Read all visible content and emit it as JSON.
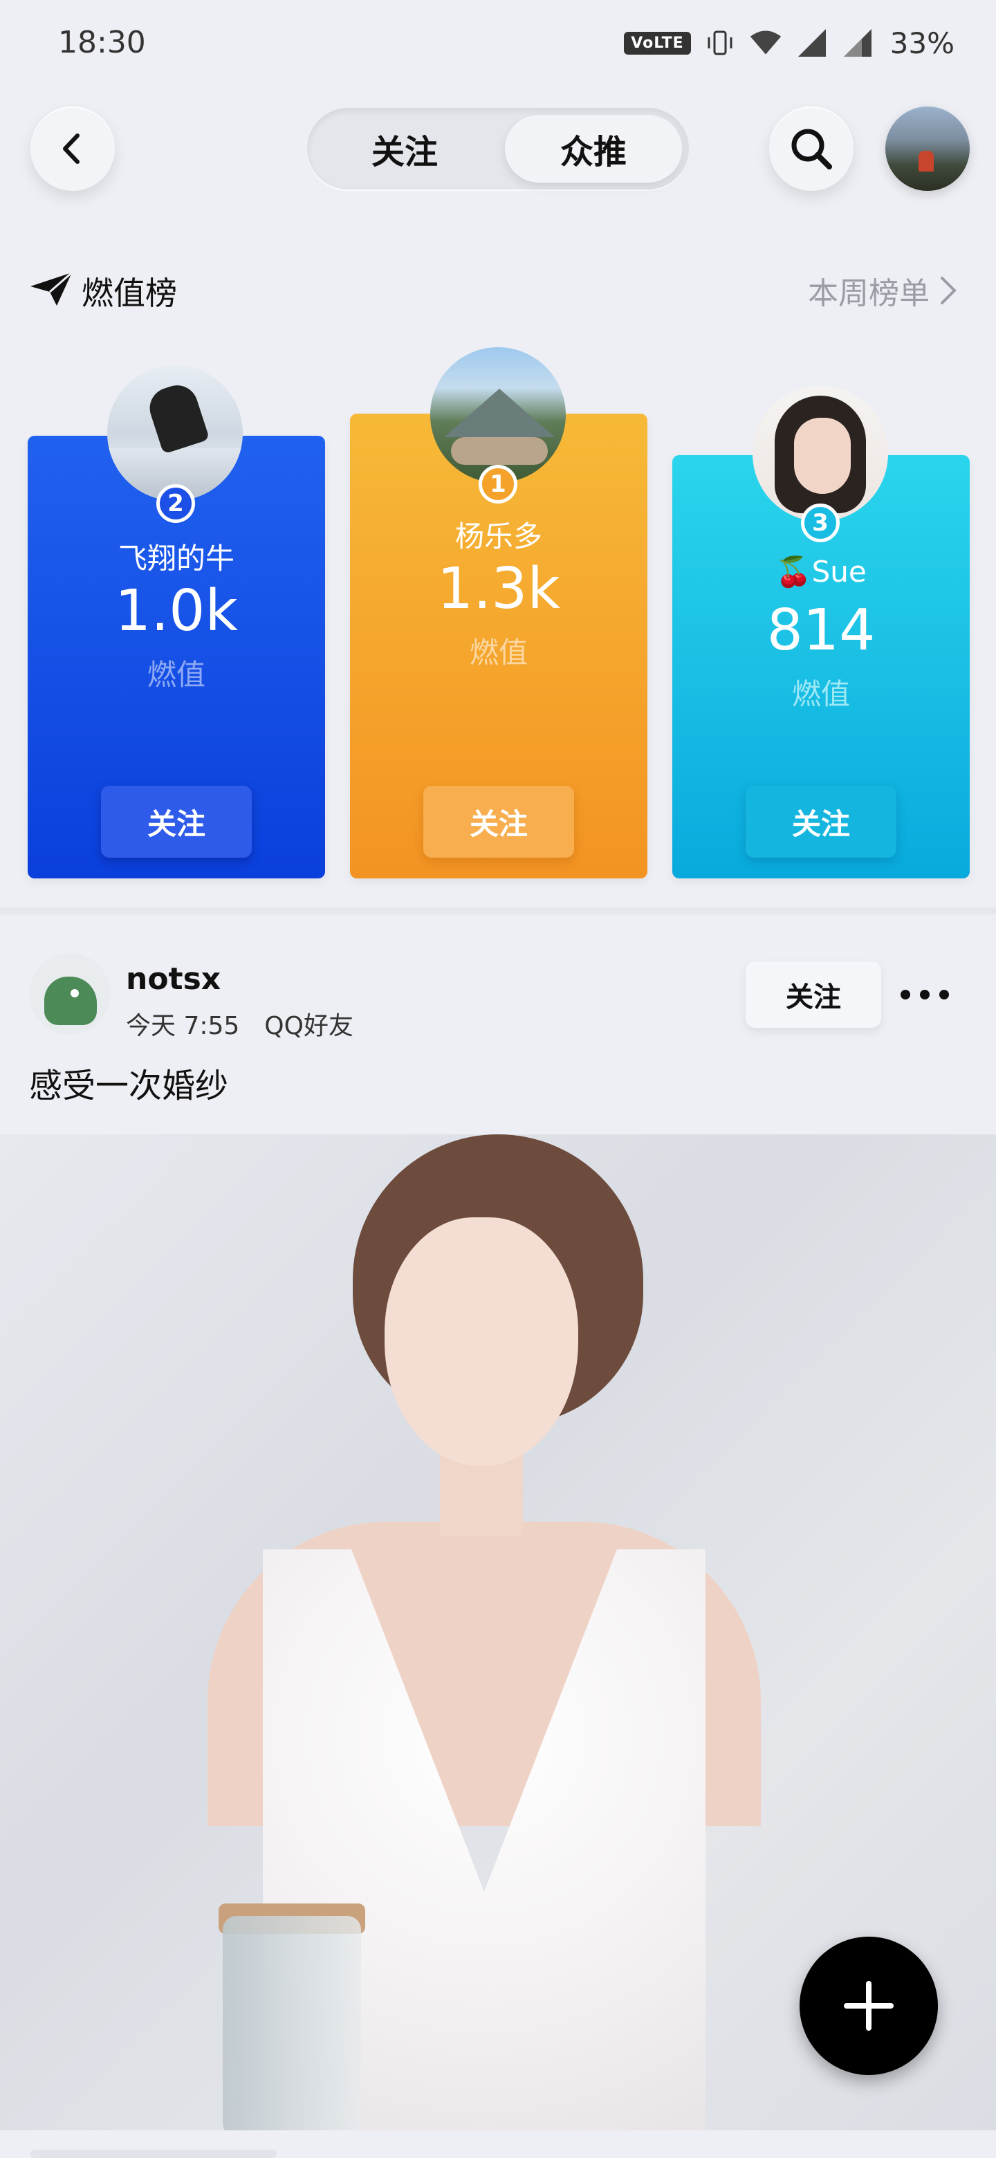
{
  "status_bar": {
    "time": "18:30",
    "volte": "VoLTE",
    "battery": "33%",
    "icons": [
      "volte-icon",
      "vibrate-icon",
      "wifi-icon",
      "signal-icon",
      "signal-icon"
    ]
  },
  "header": {
    "tabs": [
      {
        "label": "关注",
        "active": false
      },
      {
        "label": "众推",
        "active": true
      }
    ],
    "icons": [
      "back-arrow-icon",
      "search-icon",
      "user-avatar"
    ]
  },
  "leaderboard": {
    "title": "燃值榜",
    "link": "本周榜单",
    "icon": "paper-plane-icon",
    "ranks": [
      {
        "rank": "2",
        "name": "飞翔的牛",
        "score": "1.0k",
        "unit": "燃值",
        "follow": "关注",
        "color": "#0a3fdc"
      },
      {
        "rank": "1",
        "name": "杨乐多",
        "score": "1.3k",
        "unit": "燃值",
        "follow": "关注",
        "color": "#f39322"
      },
      {
        "rank": "3",
        "name": "🍒Sue",
        "score": "814",
        "unit": "燃值",
        "follow": "关注",
        "color": "#08aadd"
      }
    ]
  },
  "post": {
    "user": "notsx",
    "time": "今天 7:55",
    "source": "QQ好友",
    "follow": "关注",
    "text": "感受一次婚纱"
  },
  "colors": {
    "background": "#eeeff4",
    "rank_2": "#1e58ec",
    "rank_1": "#f5a42b",
    "rank_3": "#1ec2e6",
    "unit_text_blue": "#8ea9f5",
    "unit_text_orange": "#fcd7a2",
    "unit_text_cyan": "#9ee8f6"
  }
}
